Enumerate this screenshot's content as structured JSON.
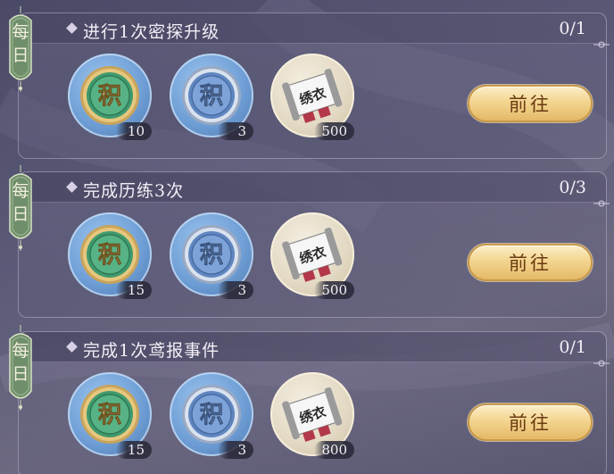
{
  "tasks": [
    {
      "daily_label": [
        "每",
        "日"
      ],
      "title": "进行1次密探升级",
      "progress": "0/1",
      "rewards": [
        {
          "icon": "green-points-coin-icon",
          "glyph": "积",
          "count": "10"
        },
        {
          "icon": "blue-points-coin-icon",
          "glyph": "积",
          "count": "3"
        },
        {
          "icon": "embroidered-guard-scroll-icon",
          "glyph": "绣衣",
          "count": "500"
        }
      ],
      "button_label": "前往"
    },
    {
      "daily_label": [
        "每",
        "日"
      ],
      "title": "完成历练3次",
      "progress": "0/3",
      "rewards": [
        {
          "icon": "green-points-coin-icon",
          "glyph": "积",
          "count": "15"
        },
        {
          "icon": "blue-points-coin-icon",
          "glyph": "积",
          "count": "3"
        },
        {
          "icon": "embroidered-guard-scroll-icon",
          "glyph": "绣衣",
          "count": "500"
        }
      ],
      "button_label": "前往"
    },
    {
      "daily_label": [
        "每",
        "日"
      ],
      "title": "完成1次鸢报事件",
      "progress": "0/1",
      "rewards": [
        {
          "icon": "green-points-coin-icon",
          "glyph": "积",
          "count": "15"
        },
        {
          "icon": "blue-points-coin-icon",
          "glyph": "积",
          "count": "3"
        },
        {
          "icon": "embroidered-guard-scroll-icon",
          "glyph": "绣衣",
          "count": "800"
        }
      ],
      "button_label": "前往"
    }
  ],
  "colors": {
    "background": "#5b5b78",
    "tag_green": "#6f8f6a",
    "button_gold": "#f3d58f",
    "button_text": "#6a3a12",
    "green_coin": "#3f9a6e",
    "blue_coin": "#6f9fd6"
  }
}
